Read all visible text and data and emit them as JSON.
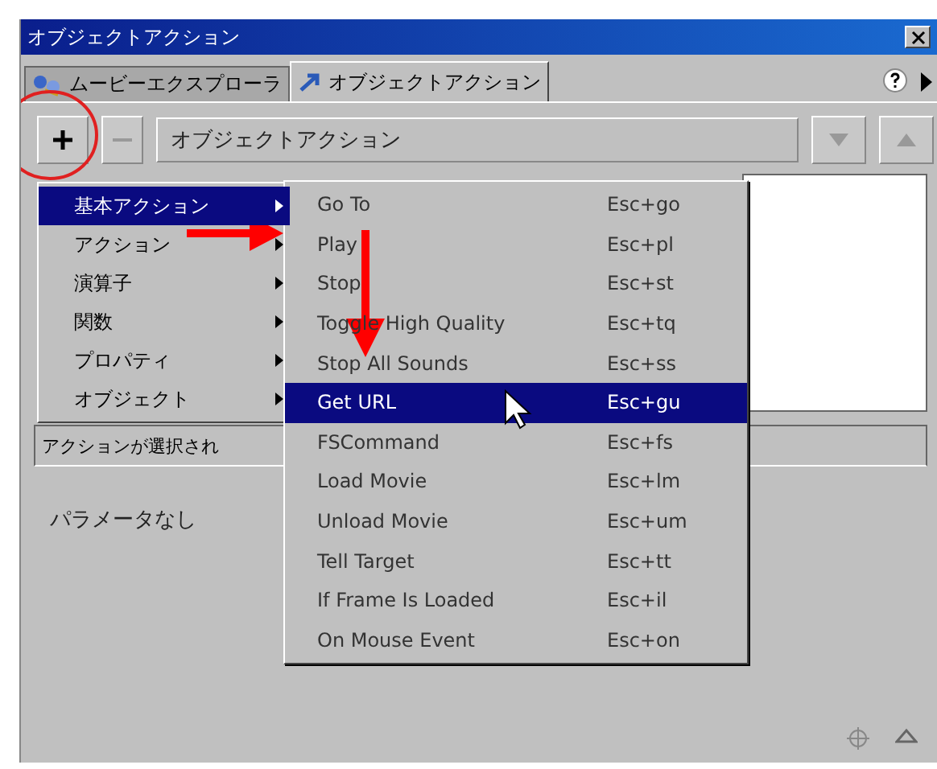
{
  "window": {
    "title": "オブジェクトアクション"
  },
  "tabs": [
    {
      "label": "ムービーエクスプローラ",
      "selected": false,
      "kind": "explorer"
    },
    {
      "label": "オブジェクトアクション",
      "selected": true,
      "kind": "action"
    }
  ],
  "toolbar": {
    "field_value": "オブジェクトアクション"
  },
  "menu": {
    "items": [
      {
        "label": "基本アクション",
        "selected": true
      },
      {
        "label": "アクション",
        "selected": false
      },
      {
        "label": "演算子",
        "selected": false
      },
      {
        "label": "関数",
        "selected": false
      },
      {
        "label": "プロパティ",
        "selected": false
      },
      {
        "label": "オブジェクト",
        "selected": false
      }
    ]
  },
  "submenu": {
    "items": [
      {
        "label": "Go To",
        "shortcut": "Esc+go",
        "selected": false
      },
      {
        "label": "Play",
        "shortcut": "Esc+pl",
        "selected": false
      },
      {
        "label": "Stop",
        "shortcut": "Esc+st",
        "selected": false
      },
      {
        "label": "Toggle High Quality",
        "shortcut": "Esc+tq",
        "selected": false
      },
      {
        "label": "Stop All Sounds",
        "shortcut": "Esc+ss",
        "selected": false
      },
      {
        "label": "Get URL",
        "shortcut": "Esc+gu",
        "selected": true
      },
      {
        "label": "FSCommand",
        "shortcut": "Esc+fs",
        "selected": false
      },
      {
        "label": "Load Movie",
        "shortcut": "Esc+lm",
        "selected": false
      },
      {
        "label": "Unload Movie",
        "shortcut": "Esc+um",
        "selected": false
      },
      {
        "label": "Tell Target",
        "shortcut": "Esc+tt",
        "selected": false
      },
      {
        "label": "If Frame Is Loaded",
        "shortcut": "Esc+il",
        "selected": false
      },
      {
        "label": "On Mouse Event",
        "shortcut": "Esc+on",
        "selected": false
      }
    ]
  },
  "status": "アクションが選択され",
  "parameters": "パラメータなし"
}
